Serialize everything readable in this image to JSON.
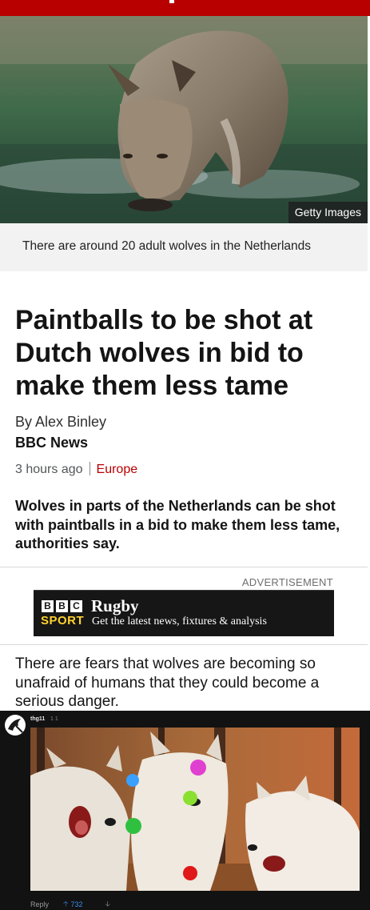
{
  "image": {
    "credit": "Getty Images",
    "caption": "There are around 20 adult wolves in the Netherlands"
  },
  "article": {
    "headline": "Paintballs to be shot at Dutch wolves in bid to make them less tame",
    "byline": "By Alex Binley",
    "source": "BBC News",
    "time": "3 hours ago",
    "section": "Europe",
    "intro": "Wolves in parts of the Netherlands can be shot with paintballs in a bid to make them less tame, authorities say.",
    "paragraph": "There are fears that wolves are becoming so unafraid of humans that they could become a serious danger."
  },
  "advert": {
    "label": "ADVERTISEMENT",
    "logo_letters": [
      "B",
      "B",
      "C"
    ],
    "logo_word": "SPORT",
    "title": "Rugby",
    "subtitle": "Get the latest news, fixtures & analysis"
  },
  "comment": {
    "username": "thg11",
    "time": "1 1",
    "reply_label": "Reply",
    "upvotes": "732"
  },
  "colors": {
    "brand_red": "#b80000",
    "accent_yellow": "#ffd230",
    "vote_blue": "#3a8de8"
  },
  "icons": [
    "upvote-arrow-icon",
    "downvote-arrow-icon",
    "user-avatar-icon"
  ]
}
